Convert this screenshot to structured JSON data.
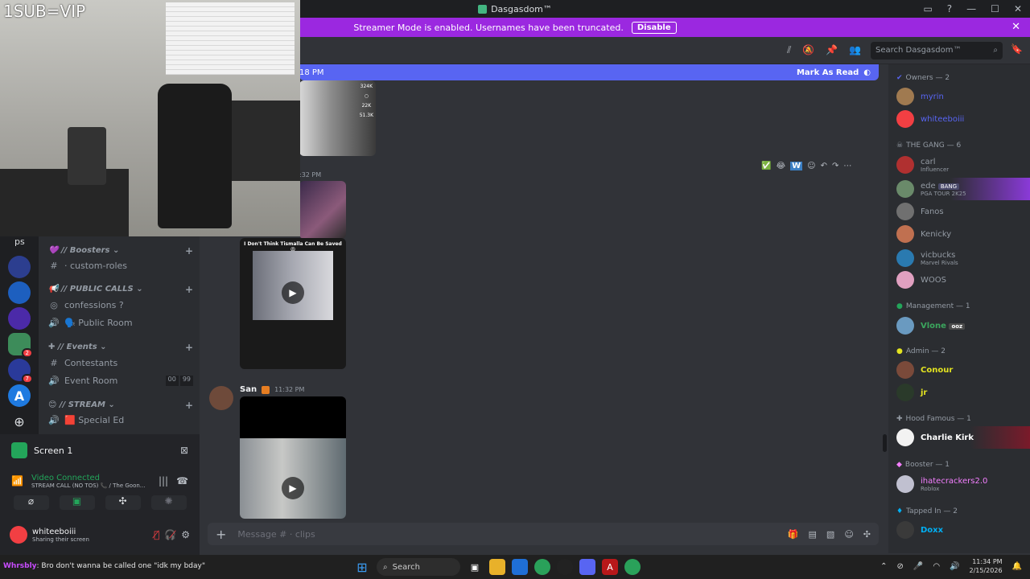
{
  "window": {
    "title": "Dasgasdom™",
    "controls": [
      "▭",
      "?",
      "—",
      "☐",
      "✕"
    ]
  },
  "banner": {
    "text": "Streamer Mode is enabled. Usernames have been truncated.",
    "button": "Disable"
  },
  "header": {
    "search_placeholder": "Search Dasgasdom™"
  },
  "new_messages": {
    "time_fragment": "18 PM",
    "mark_read": "Mark As Read"
  },
  "webcam": {
    "overlay_text": "1SUB=VIP"
  },
  "servers": [
    {
      "badge": ""
    },
    {
      "badge": ""
    },
    {
      "badge": ""
    },
    {
      "badge": "2"
    },
    {
      "badge": "7"
    },
    {
      "badge": ""
    }
  ],
  "channels": {
    "top_fragment": "ps",
    "categories": [
      {
        "name": "// Boosters",
        "emoji": "💜",
        "channels": [
          {
            "icon": "#",
            "name": "· custom-roles"
          }
        ]
      },
      {
        "name": "// PUBLIC CALLS",
        "emoji": "📢",
        "channels": [
          {
            "icon": "◎",
            "name": "confessions ?"
          },
          {
            "icon": "🔊",
            "name": "🗣️ Public Room"
          }
        ]
      },
      {
        "name": "// Events",
        "emoji": "✚",
        "channels": [
          {
            "icon": "#",
            "name": "Contestants"
          },
          {
            "icon": "🔊",
            "name": "Event Room",
            "counts": [
              "00",
              "99"
            ]
          }
        ]
      },
      {
        "name": "// STREAM",
        "emoji": "😊",
        "channels": [
          {
            "icon": "🔊",
            "name": "🟥 Special Ed"
          }
        ]
      }
    ]
  },
  "voice_panel": {
    "screen_label": "Screen 1",
    "status": "Video Connected",
    "channel": "STREAM CALL (NO TOS) 📞 / The Goon...",
    "user_name": "whiteeboiii",
    "user_status": "Sharing their screen"
  },
  "chat": {
    "msg1_stats": [
      "324K",
      "22K",
      "51.3K"
    ],
    "msg2_time_fragment": ":32 PM",
    "msg2_reactions": [
      "✅",
      "😂",
      "W"
    ],
    "video1_caption": "I Don't Think Tismalla Can Be Saved😩",
    "msg3_author": "San",
    "msg3_time": "11:32 PM"
  },
  "composer": {
    "placeholder": "Message # · clips"
  },
  "members": {
    "groups": [
      {
        "title": "Owners — 2",
        "members": [
          {
            "name": "myrin",
            "sub": "",
            "color": "#5865f2"
          },
          {
            "name": "whiteeboiii",
            "sub": "",
            "color": "#5865f2"
          }
        ]
      },
      {
        "title": "THE GANG — 6",
        "members": [
          {
            "name": "carl",
            "sub": "Influencer",
            "color": "#949ba4"
          },
          {
            "name": "ede",
            "sub": "PGA TOUR 2K25",
            "color": "#949ba4",
            "tag": "BANG"
          },
          {
            "name": "Fanos",
            "sub": "",
            "color": "#949ba4"
          },
          {
            "name": "Kenicky",
            "sub": "",
            "color": "#949ba4"
          },
          {
            "name": "vicbucks",
            "sub": "Marvel Rivals",
            "color": "#949ba4"
          },
          {
            "name": "WOOS",
            "sub": "",
            "color": "#949ba4"
          }
        ]
      },
      {
        "title": "Management — 1",
        "members": [
          {
            "name": "Vlone",
            "sub": "",
            "color": "#3ba55d",
            "tag": "ooz"
          }
        ]
      },
      {
        "title": "Admin — 2",
        "members": [
          {
            "name": "Conour",
            "sub": "",
            "color": "#e3e320"
          },
          {
            "name": "jr",
            "sub": "",
            "color": "#e3e320"
          }
        ]
      },
      {
        "title": "Hood Famous — 1",
        "members": [
          {
            "name": "Charlie Kirk",
            "sub": "",
            "color": "#ffffff"
          }
        ]
      },
      {
        "title": "Booster — 1",
        "members": [
          {
            "name": "ihatecrackers2.0",
            "sub": "Roblox",
            "color": "#f47fff"
          }
        ]
      },
      {
        "title": "Tapped In — 2",
        "members": [
          {
            "name": "Doxx",
            "sub": "",
            "color": "#00b0f4"
          }
        ]
      }
    ]
  },
  "taskbar": {
    "message_user": "Whrsbly",
    "message_text": ": Bro don't wanna be called one \"idk my bday\"",
    "search": "Search",
    "time": "11:34 PM",
    "date": "2/15/2026"
  }
}
